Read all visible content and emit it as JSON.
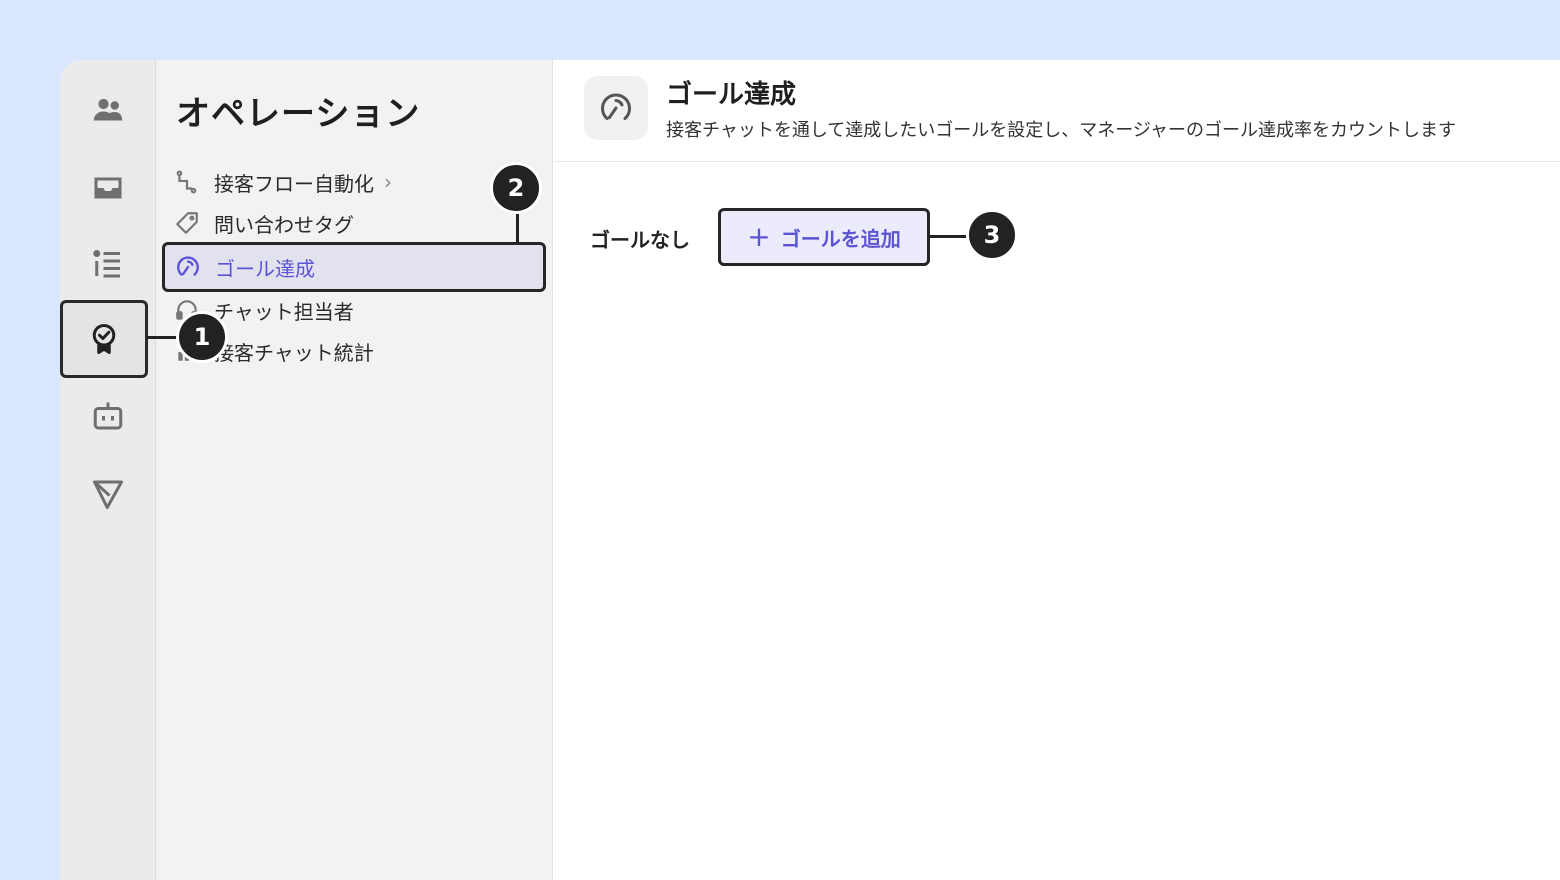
{
  "rail": {
    "items": [
      {
        "name": "users-icon"
      },
      {
        "name": "inbox-icon"
      },
      {
        "name": "list-icon"
      },
      {
        "name": "award-badge-icon",
        "active": true
      },
      {
        "name": "bot-icon"
      },
      {
        "name": "send-icon"
      }
    ]
  },
  "subnav": {
    "title": "オペレーション",
    "items": [
      {
        "label": "接客フロー自動化",
        "icon": "flow-icon",
        "has_chevron": true
      },
      {
        "label": "問い合わせタグ",
        "icon": "tag-icon"
      },
      {
        "label": "ゴール達成",
        "icon": "goal-icon",
        "active": true
      },
      {
        "label": "チャット担当者",
        "icon": "headset-icon"
      },
      {
        "label": "接客チャット統計",
        "icon": "bar-chart-icon"
      }
    ]
  },
  "main": {
    "title": "ゴール達成",
    "description": "接客チャットを通して達成したいゴールを設定し、マネージャーのゴール達成率をカウントします",
    "empty_label": "ゴールなし",
    "add_button_label": "ゴールを追加",
    "add_button_icon": "plus-icon"
  },
  "callouts": [
    "1",
    "2",
    "3"
  ],
  "colors": {
    "accent": "#5b54d6",
    "page_background": "#d9e6fd",
    "callout": "#222222"
  }
}
